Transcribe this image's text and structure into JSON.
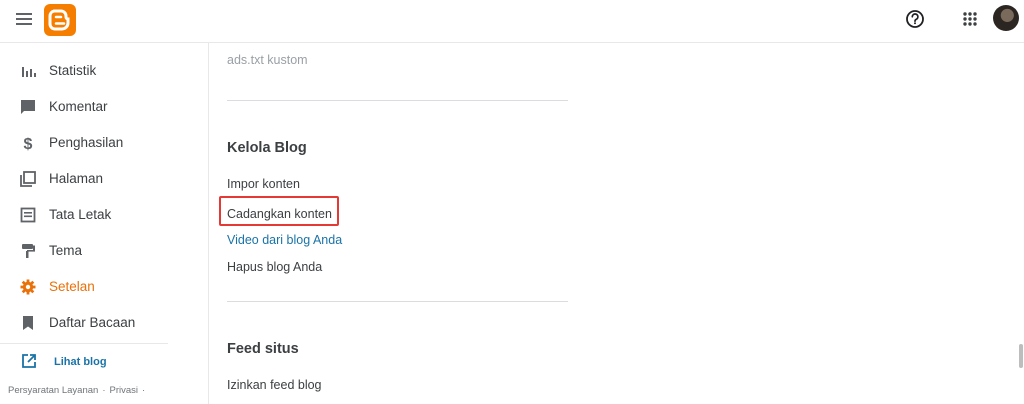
{
  "header": {
    "icons": [
      "menu-icon",
      "blogger-logo",
      "help-icon",
      "apps-icon",
      "avatar"
    ],
    "brand_color": "#f57d00"
  },
  "sidebar": {
    "items": [
      {
        "label": "Statistik",
        "icon": "stats-icon"
      },
      {
        "label": "Komentar",
        "icon": "comment-icon"
      },
      {
        "label": "Penghasilan",
        "icon": "dollar-icon"
      },
      {
        "label": "Halaman",
        "icon": "pages-icon"
      },
      {
        "label": "Tata Letak",
        "icon": "layout-icon"
      },
      {
        "label": "Tema",
        "icon": "paint-roller-icon"
      },
      {
        "label": "Setelan",
        "icon": "gear-icon",
        "active": true
      },
      {
        "label": "Daftar Bacaan",
        "icon": "bookmark-icon"
      }
    ],
    "view_blog": "Lihat blog",
    "footer": {
      "terms": "Persyaratan Layanan",
      "privacy": "Privasi",
      "sep": "·"
    },
    "active_color": "#e8710a",
    "link_color": "#1a73a8"
  },
  "main": {
    "prev_item": "ads.txt kustom",
    "manage": {
      "title": "Kelola Blog",
      "items": [
        "Impor konten",
        "Cadangkan konten",
        "Video dari blog Anda",
        "Hapus blog Anda"
      ]
    },
    "feed": {
      "title": "Feed situs",
      "items": [
        "Izinkan feed blog"
      ]
    },
    "highlight_color": "#e53935"
  }
}
